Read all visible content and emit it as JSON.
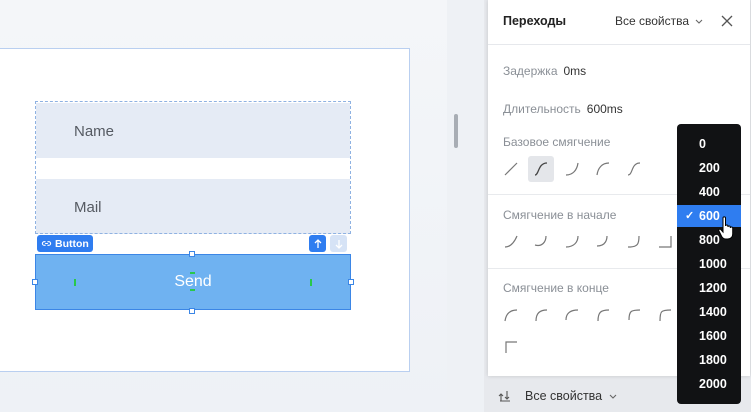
{
  "canvas": {
    "fields": [
      "Name",
      "Mail"
    ],
    "button_tag": "Button",
    "send_label": "Send"
  },
  "panel": {
    "title": "Переходы",
    "filter": "Все свойства",
    "delay_label": "Задержка",
    "delay_value": "0ms",
    "duration_label": "Длительность",
    "duration_value": "600ms",
    "base_easing_label": "Базовое смягчение",
    "ease_in_label": "Смягчение в начале",
    "ease_out_label": "Смягчение в конце"
  },
  "bottom": {
    "filter": "Все свойства"
  },
  "dropdown": {
    "options": [
      "0",
      "200",
      "400",
      "600",
      "800",
      "1000",
      "1200",
      "1400",
      "1600",
      "1800",
      "2000"
    ],
    "selected": "600"
  },
  "colors": {
    "accent": "#2f7df0",
    "button_fill": "#6fb2f1",
    "field_fill": "#e5ebf5"
  },
  "icons": [
    "link-icon",
    "arrow-up-icon",
    "arrow-down-icon",
    "close-icon",
    "chevron-down-icon",
    "transition-icon",
    "checkmark-icon",
    "hand-cursor-icon"
  ]
}
